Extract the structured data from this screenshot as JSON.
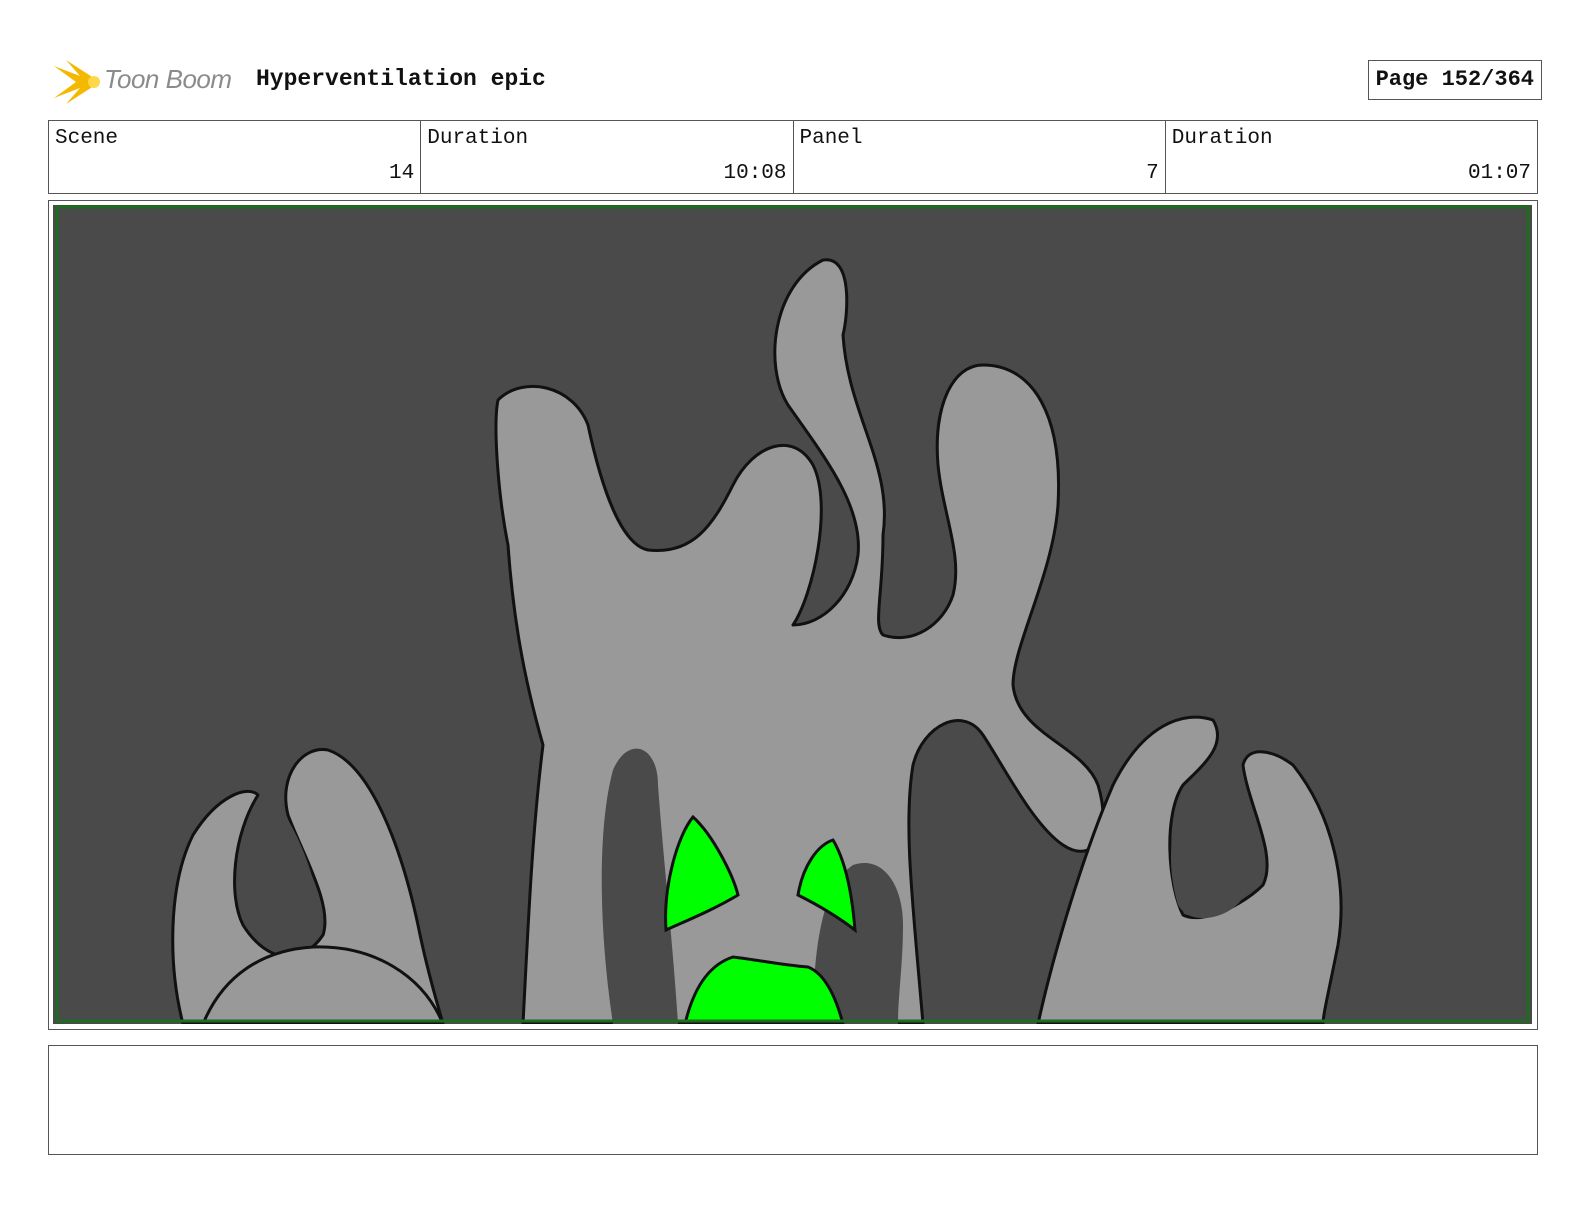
{
  "header": {
    "brand": "Toon Boom",
    "title": "Hyperventilation epic",
    "page": "Page 152/364"
  },
  "info": [
    {
      "label": "Scene",
      "value": "14"
    },
    {
      "label": "Duration",
      "value": "10:08"
    },
    {
      "label": "Panel",
      "value": "7"
    },
    {
      "label": "Duration",
      "value": "01:07"
    }
  ],
  "colors": {
    "background": "#4a4a4a",
    "creature": "#999999",
    "shadow": "#5c5c5c",
    "glow": "#00ff00",
    "safe_frame": "#1f6b1f",
    "logo": "#f5b800"
  },
  "notes": ""
}
